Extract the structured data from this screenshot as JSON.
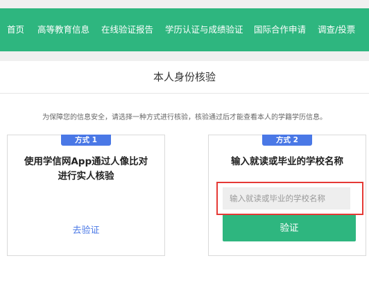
{
  "nav": {
    "items": [
      {
        "label": "首页"
      },
      {
        "label": "高等教育信息"
      },
      {
        "label": "在线验证报告"
      },
      {
        "label": "学历认证与成绩验证"
      },
      {
        "label": "国际合作申请"
      },
      {
        "label": "调查/投票"
      }
    ]
  },
  "page": {
    "title": "本人身份核验",
    "notice": "为保障您的信息安全，请选择一种方式进行核验，核验通过后才能查看本人的学籍学历信息。"
  },
  "method1": {
    "badge": "方式 1",
    "title_line1": "使用学信网App通过人像比对",
    "title_line2": "进行实人核验",
    "link": "去验证"
  },
  "method2": {
    "badge": "方式 2",
    "title": "输入就读或毕业的学校名称",
    "input_placeholder": "输入就读或毕业的学校名称",
    "input_value": "",
    "button": "验证"
  },
  "colors": {
    "nav_background": "#2eb67f",
    "badge": "#4a78e6",
    "highlight": "#e53935"
  }
}
